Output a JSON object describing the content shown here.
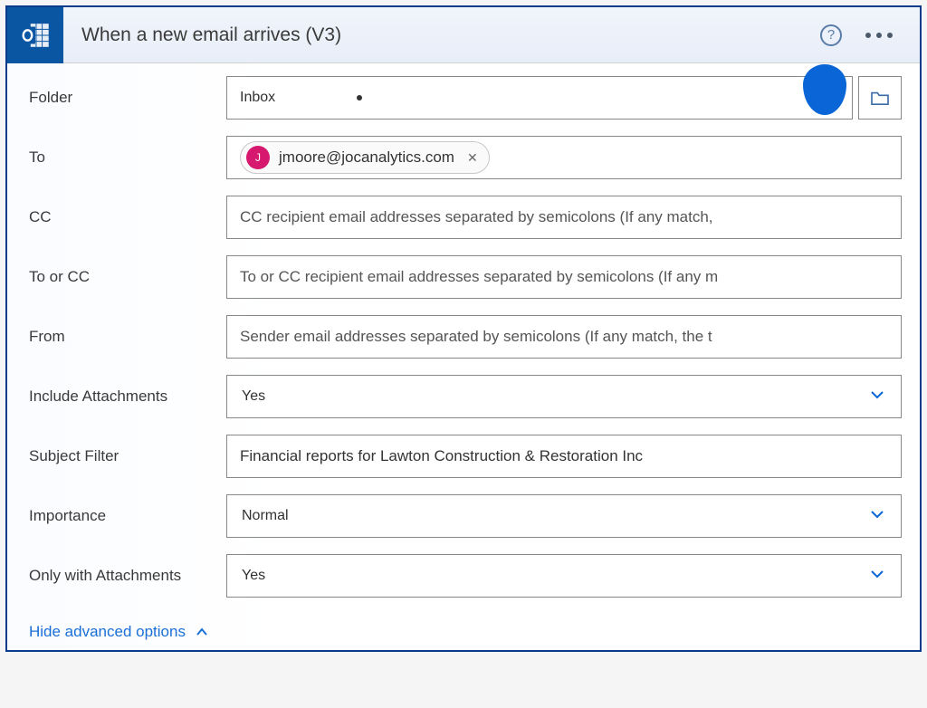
{
  "header": {
    "title": "When a new email arrives (V3)"
  },
  "fields": {
    "folder": {
      "label": "Folder",
      "value": "Inbox"
    },
    "to": {
      "label": "To",
      "chip": {
        "initial": "J",
        "email": "jmoore@jocanalytics.com"
      }
    },
    "cc": {
      "label": "CC",
      "placeholder": "CC recipient email addresses separated by semicolons (If any match,"
    },
    "to_or_cc": {
      "label": "To or CC",
      "placeholder": "To or CC recipient email addresses separated by semicolons (If any m"
    },
    "from": {
      "label": "From",
      "placeholder": "Sender email addresses separated by semicolons (If any match, the t"
    },
    "include_attachments": {
      "label": "Include Attachments",
      "value": "Yes"
    },
    "subject_filter": {
      "label": "Subject Filter",
      "value": "Financial reports for Lawton Construction & Restoration Inc"
    },
    "importance": {
      "label": "Importance",
      "value": "Normal"
    },
    "only_with_attachments": {
      "label": "Only with Attachments",
      "value": "Yes"
    }
  },
  "footer": {
    "hide_advanced": "Hide advanced options"
  }
}
